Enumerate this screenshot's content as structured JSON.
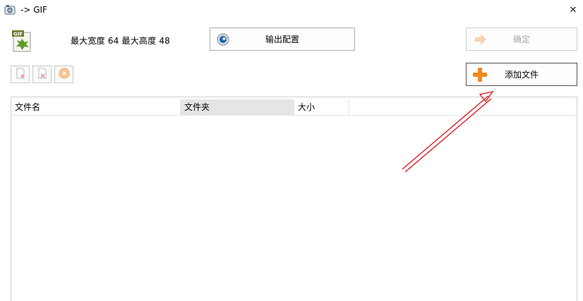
{
  "window": {
    "title": "-> GIF",
    "close_symbol": "✕"
  },
  "info": {
    "dimensions_text": "最大宽度 64 最大高度 48"
  },
  "buttons": {
    "config_label": "输出配置",
    "ok_label": "确定",
    "add_label": "添加文件"
  },
  "file_list": {
    "columns": [
      "文件名",
      "文件夹",
      "大小"
    ],
    "rows": []
  },
  "colors": {
    "add_icon": "#f28a1e",
    "annotation_arrow": "#e21b22",
    "config_icon": "#1f5fa8"
  }
}
